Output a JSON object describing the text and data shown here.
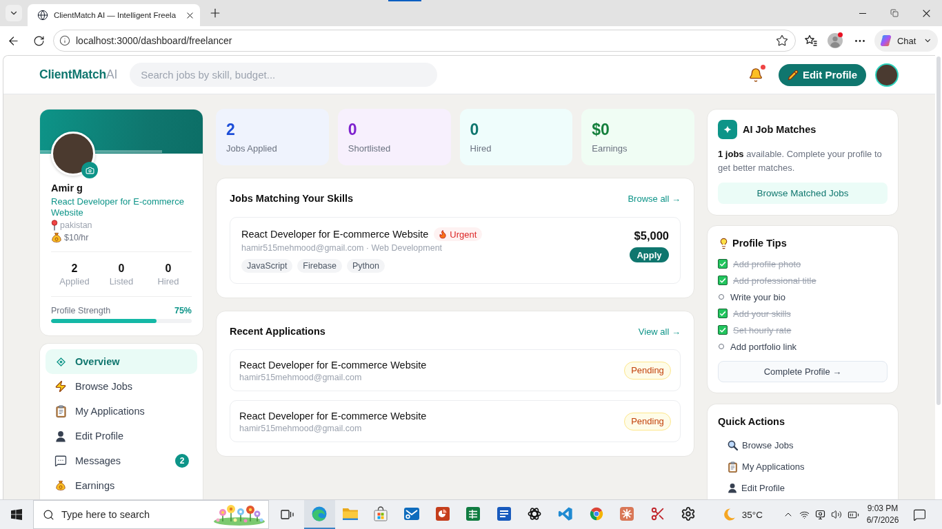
{
  "browser": {
    "tab_title": "ClientMatch AI — Intelligent Freela",
    "address": "localhost:3000/dashboard/freelancer",
    "profile_alert": true,
    "chat_label": "Chat"
  },
  "header": {
    "logo": {
      "name": "ClientMatch",
      "suffix": "AI"
    },
    "search": {
      "placeholder": "Search jobs by skill, budget..."
    },
    "has_notifications": true,
    "edit_button": "Edit Profile"
  },
  "profile": {
    "name": "Amir g",
    "title": "React Developer for E-commerce Website",
    "location": "pakistan",
    "rate": "$10/hr",
    "stats": [
      {
        "value": "2",
        "label": "Applied"
      },
      {
        "value": "0",
        "label": "Listed"
      },
      {
        "value": "0",
        "label": "Hired"
      }
    ],
    "strength": {
      "label": "Profile Strength",
      "reading": "75%",
      "level": 0.75
    }
  },
  "nav": [
    {
      "label": "Overview",
      "selected": true
    },
    {
      "label": "Browse Jobs",
      "selected": false
    },
    {
      "label": "My Applications",
      "selected": false
    },
    {
      "label": "Edit Profile",
      "selected": false
    },
    {
      "label": "Messages",
      "selected": false,
      "badge": "2"
    },
    {
      "label": "Earnings",
      "selected": false
    }
  ],
  "stats": [
    {
      "value": "2",
      "label": "Jobs Applied",
      "color": "#1d4ed8"
    },
    {
      "value": "0",
      "label": "Shortlisted",
      "color": "#7e22ce"
    },
    {
      "value": "0",
      "label": "Hired",
      "color": "#0f766e"
    },
    {
      "value": "$0",
      "label": "Earnings",
      "color": "#15803d"
    }
  ],
  "matching_jobs": {
    "title": "Jobs Matching Your Skills",
    "link": "Browse all →",
    "jobs": [
      {
        "title": "React Developer for E-commerce Website",
        "badge": "Urgent",
        "meta": "hamir515mehmood@gmail.com · Web Development",
        "tags": [
          "JavaScript",
          "Firebase",
          "Python"
        ],
        "budget": "$5,000",
        "action": "Apply"
      }
    ]
  },
  "recent_applications": {
    "title": "Recent Applications",
    "link": "View all →",
    "items": [
      {
        "title": "React Developer for E-commerce Website",
        "email": "hamir515mehmood@gmail.com",
        "status": "Pending"
      },
      {
        "title": "React Developer for E-commerce Website",
        "email": "hamir515mehmood@gmail.com",
        "status": "Pending"
      }
    ]
  },
  "ai_matches": {
    "title": "AI Job Matches",
    "text": "**1 jobs** available. Complete your profile to get better matches.",
    "button": "Browse Matched Jobs"
  },
  "profile_tips": {
    "title": "Profile Tips",
    "items": [
      {
        "label": "Add profile photo",
        "checked": true
      },
      {
        "label": "Add professional title",
        "checked": true
      },
      {
        "label": "Write your bio",
        "checked": false
      },
      {
        "label": "Add your skills",
        "checked": true
      },
      {
        "label": "Set hourly rate",
        "checked": true
      },
      {
        "label": "Add portfolio link",
        "checked": false
      }
    ],
    "button": "Complete Profile →"
  },
  "quick_actions": {
    "title": "Quick Actions",
    "items": [
      "Browse Jobs",
      "My Applications",
      "Edit Profile"
    ]
  },
  "taskbar": {
    "search": {
      "placeholder": "Type here to search"
    },
    "apps": [
      {
        "selected": true
      },
      {
        "selected": false
      },
      {
        "selected": false
      },
      {
        "selected": false
      },
      {
        "selected": false
      },
      {
        "selected": false
      },
      {
        "selected": false
      },
      {
        "selected": false
      },
      {
        "selected": false
      },
      {
        "selected": false
      },
      {
        "selected": false
      },
      {
        "selected": false
      },
      {
        "selected": false
      }
    ],
    "weather": "35°C",
    "time": "9:03 PM",
    "date": "6/7/2026"
  }
}
